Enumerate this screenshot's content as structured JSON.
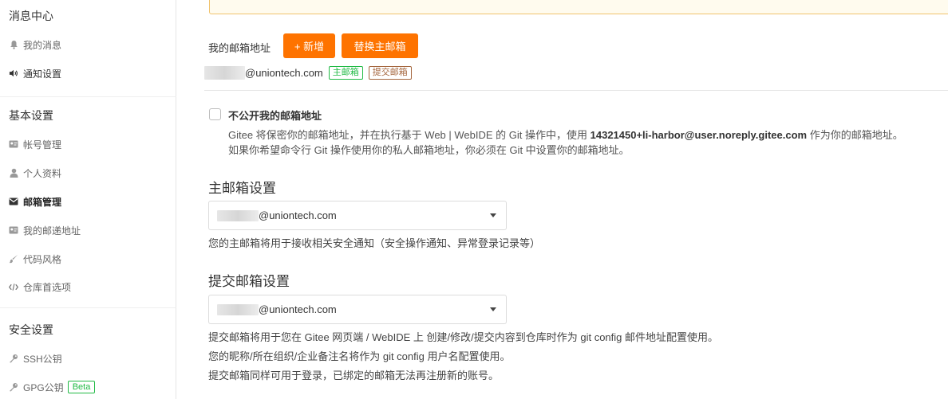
{
  "sidebar": {
    "message_center": {
      "title": "消息中心",
      "items": [
        {
          "label": "我的消息",
          "icon": "bell-icon"
        },
        {
          "label": "通知设置",
          "icon": "volume-icon"
        }
      ]
    },
    "basic_settings": {
      "title": "基本设置",
      "items": [
        {
          "label": "帐号管理",
          "icon": "id-card-icon"
        },
        {
          "label": "个人资料",
          "icon": "user-icon"
        },
        {
          "label": "邮箱管理",
          "icon": "envelope-icon"
        },
        {
          "label": "我的邮递地址",
          "icon": "address-card-icon"
        },
        {
          "label": "代码风格",
          "icon": "brush-icon"
        },
        {
          "label": "仓库首选项",
          "icon": "code-icon"
        }
      ]
    },
    "security_settings": {
      "title": "安全设置",
      "items": [
        {
          "label": "SSH公钥",
          "icon": "key-icon"
        },
        {
          "label": "GPG公钥",
          "icon": "key-icon",
          "badge": "Beta"
        }
      ]
    }
  },
  "email_section": {
    "label": "我的邮箱地址",
    "add_button": "+ 新增",
    "replace_button": "替换主邮箱",
    "email_suffix": "@uniontech.com",
    "tag_primary": "主邮箱",
    "tag_commit": "提交邮箱"
  },
  "privacy": {
    "checkbox_label": "不公开我的邮箱地址",
    "desc_line1_pre": "Gitee 将保密你的邮箱地址，并在执行基于 Web | WebIDE 的 Git 操作中，使用 ",
    "desc_line1_email": "14321450+li-harbor@user.noreply.gitee.com",
    "desc_line1_post": " 作为你的邮箱地址。",
    "desc_line2": "如果你希望命令行 Git 操作使用你的私人邮箱地址，你必须在 Git 中设置你的邮箱地址。"
  },
  "primary_email": {
    "title": "主邮箱设置",
    "selected": "@uniontech.com",
    "help": "您的主邮箱将用于接收相关安全通知（安全操作通知、异常登录记录等）"
  },
  "commit_email": {
    "title": "提交邮箱设置",
    "selected": "@uniontech.com",
    "help_lines": [
      "提交邮箱将用于您在 Gitee 网页端 / WebIDE 上 创建/修改/提交内容到仓库时作为 git config 邮件地址配置使用。",
      "您的昵称/所在组织/企业备注名将作为 git config 用户名配置使用。",
      "提交邮箱同样可用于登录，已绑定的邮箱无法再注册新的账号。"
    ]
  },
  "colors": {
    "accent": "#fe7300",
    "tag_green": "#21ba45",
    "tag_brown": "#a5673f"
  }
}
